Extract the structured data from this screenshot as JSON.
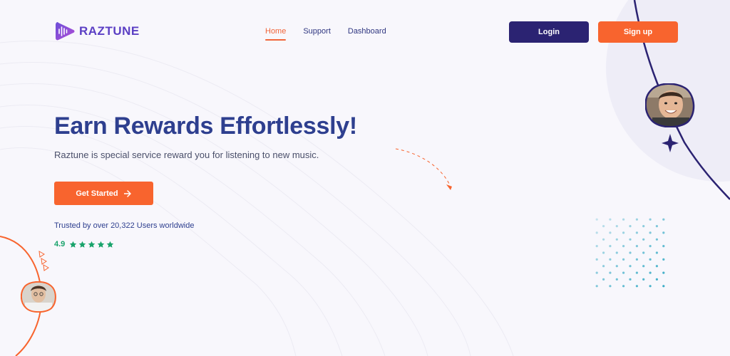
{
  "brand": {
    "name": "RAZTUNE",
    "primary_color": "#2b2372",
    "accent_color": "#f8642e"
  },
  "nav": {
    "items": [
      {
        "label": "Home",
        "active": true
      },
      {
        "label": "Support",
        "active": false
      },
      {
        "label": "Dashboard",
        "active": false
      }
    ]
  },
  "header": {
    "login_label": "Login",
    "signup_label": "Sign up"
  },
  "hero": {
    "title": "Earn Rewards Effortlessly!",
    "subtitle": "Raztune is special service reward you for listening to new music.",
    "cta_label": "Get Started",
    "trusted_text": "Trusted by over 20,322 Users worldwide",
    "rating_value": "4.9",
    "stars": 5
  },
  "icons": {
    "logo": "play-soundwave-icon",
    "cta": "arrow-right-icon",
    "rating": "star-icon",
    "sparkle": "four-point-star-icon"
  }
}
